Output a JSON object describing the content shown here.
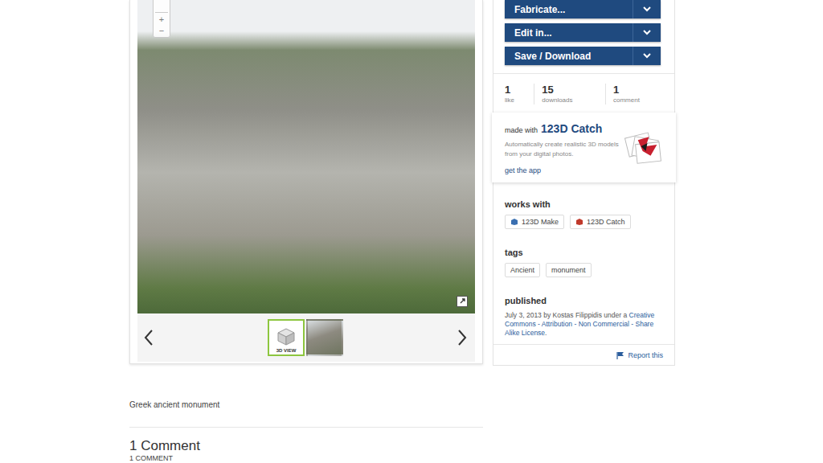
{
  "viewer": {
    "zoom_in": "+",
    "zoom_out": "−",
    "thumbnails": [
      {
        "kind": "model",
        "label": "3D VIEW",
        "selected": true
      },
      {
        "kind": "photo",
        "selected": false
      }
    ]
  },
  "description": "Greek ancient monument",
  "comments": {
    "title": "1 Comment",
    "count": "1 COMMENT"
  },
  "actions": [
    "Fabricate...",
    "Edit in...",
    "Save / Download"
  ],
  "stats": [
    {
      "value": "1",
      "label": "like"
    },
    {
      "value": "15",
      "label": "downloads"
    },
    {
      "value": "1",
      "label": "comment"
    }
  ],
  "made_with": {
    "prefix": "made with",
    "app": "123D Catch",
    "description": "Automatically create realistic 3D models from your digital photos.",
    "link": "get the app"
  },
  "works_with": {
    "title": "works with",
    "apps": [
      {
        "label": "123D Make",
        "color": "#3a6fb0"
      },
      {
        "label": "123D Catch",
        "color": "#c0392b"
      }
    ]
  },
  "tags": {
    "title": "tags",
    "items": [
      "Ancient",
      "monument"
    ]
  },
  "published": {
    "title": "published",
    "segments": [
      {
        "text": "July 3, 2013 by Kostas Filippidis under a ",
        "link": false
      },
      {
        "text": "Creative Commons - Attribution - Non Commercial - Share Alike License",
        "link": true
      },
      {
        "text": ".",
        "link": false
      }
    ]
  },
  "report": "Report this"
}
